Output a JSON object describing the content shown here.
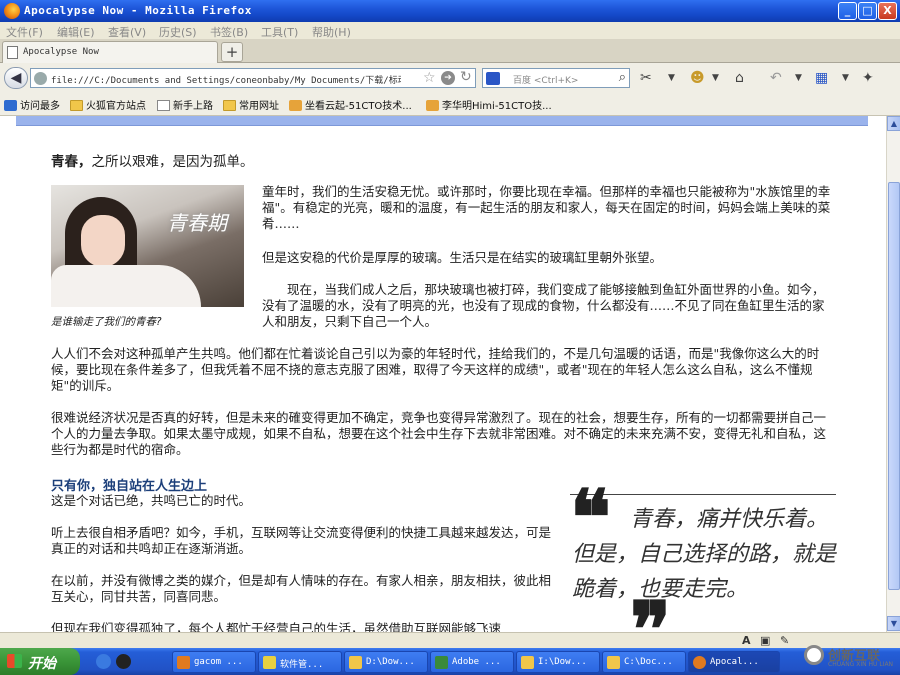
{
  "window": {
    "title": "Apocalypse Now - Mozilla Firefox",
    "min_label": "_",
    "max_label": "□",
    "close_label": "X"
  },
  "menu": [
    "文件(F)",
    "编辑(E)",
    "查看(V)",
    "历史(S)",
    "书签(B)",
    "工具(T)",
    "帮助(H)"
  ],
  "tab": {
    "label": "Apocalypse Now",
    "new_tab": "+"
  },
  "nav": {
    "back": "◀",
    "url": "file:///C:/Documents and Settings/coneonbaby/My Documents/下载/标动",
    "search_engine": "百度",
    "search_placeholder": "<Ctrl+K>"
  },
  "bookmarks": [
    "访问最多",
    "火狐官方站点",
    "新手上路",
    "常用网址",
    "坐看云起-51CTO技术...",
    "李华明Himi-51CTO技..."
  ],
  "article": {
    "lead_bold": "青春，",
    "lead_rest": "之所以艰难，是因为孤单。",
    "p1": "童年时，我们的生活安稳无忧。或许那时，你要比现在幸福。但那样的幸福也只能被称为\"水族馆里的幸福\"。有稳定的光亮，暖和的温度，有一起生活的朋友和家人，每天在固定的时间，妈妈会端上美味的菜肴……",
    "p2": "但是这安稳的代价是厚厚的玻璃。生活只是在结实的玻璃缸里朝外张望。",
    "p3": "现在，当我们成人之后，那块玻璃也被打碎，我们变成了能够接触到鱼缸外面世界的小鱼。如今，没有了温暖的水，没有了明亮的光，也没有了现成的食物，什么都没有……不见了同在鱼缸里生活的家人和朋友，只剩下自己一个人。",
    "p4": "人人们不会对这种孤单产生共鸣。他们都在忙着谈论自己引以为豪的年轻时代，挂给我们的，不是几句温暖的话语，而是\"我像你这么大的时候，要比现在条件差多了，但我凭着不屈不挠的意志克服了困难，取得了今天这样的成绩\"，或者\"现在的年轻人怎么这么自私，这么不懂规矩\"的训斥。",
    "p5": "很难说经济状况是否真的好转，但是未来的確变得更加不确定，竞争也变得异常激烈了。现在的社会，想要生存，所有的一切都需要拼自己一个人的力量去争取。如果太墨守成规，如果不自私，想要在这个社会中生存下去就非常困难。对不确定的未来充满不安，变得无礼和自私，这些行为都是时代的宿命。",
    "caption": "是谁输走了我们的青春?",
    "photo_overlay": "青春期",
    "subhead": "只有你，独自站在人生边上",
    "p6": "这是个对话已绝，共鸣已亡的时代。",
    "p7": "听上去很自相矛盾吧？如今，手机，互联网等让交流变得便利的快捷工具越来越发达，可是真正的对话和共鸣却正在逐渐消逝。",
    "p8": "在以前，并没有微博之类的媒介，但是却有人情味的存在。有家人相亲，朋友相扶，彼此相互关心，同甘共苦，同喜同悲。",
    "p9": "但现在我们变得孤独了，每个人都忙于经营自己的生活，虽然借助互联网能够飞速",
    "pullquote": "青春，痛并快乐着。但是，自己选择的路，就是跪着，也要走完。",
    "quote_open": "❝",
    "quote_close": "❞"
  },
  "taskbar": {
    "start": "开始",
    "tasks": [
      "gacom ...",
      "软件管...",
      "D:\\Dow...",
      "Adobe ...",
      "I:\\Dow...",
      "C:\\Doc...",
      "Apocal..."
    ]
  },
  "watermark": {
    "text": "创新互联",
    "sub": "CHUANG XIN HU LIAN"
  },
  "colors": {
    "titlebar": "#1d55d8",
    "subhead": "#1c3f7a",
    "band": "#9ab3ec"
  }
}
